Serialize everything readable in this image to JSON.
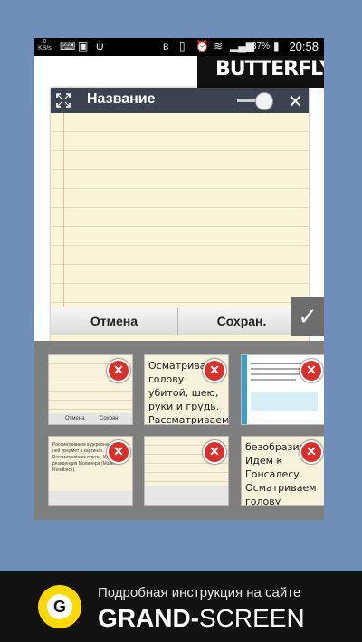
{
  "statusbar": {
    "speed_value": "0",
    "speed_unit": "KB/s",
    "battery": "87%",
    "time": "20:58"
  },
  "background_app": {
    "logo_text": "BUTTERFLY"
  },
  "memo_window": {
    "title": "Название",
    "cancel_label": "Отмена",
    "save_label": "Сохран."
  },
  "thumbnails": [
    {
      "kind": "memo",
      "cancel": "Отмена",
      "save": "Сохран."
    },
    {
      "kind": "text",
      "text": "Осматриваем голову убитой, шею, руки и грудь. Рассматриваем"
    },
    {
      "kind": "web"
    },
    {
      "kind": "small_text",
      "text": "Рассматриваем в деревню, сквозь ней предмет в картинах. Рассматриваем сквозь. Идем резиденция Молинера (Muller Roodbeck)."
    },
    {
      "kind": "memo_keyboard"
    },
    {
      "kind": "text",
      "text": "безобразия. Идем к Гонсалесу. Осматриваем голову убитой,"
    }
  ],
  "footer": {
    "logo_letter": "G",
    "tagline": "Подробная инструкция на сайте",
    "brand_bold": "GRAND-",
    "brand_light": "SCREEN"
  },
  "colors": {
    "page_bg": "#6f8fb8",
    "memo_header": "#3b4350",
    "close_badge": "#d9302b",
    "footer_bg": "#121212",
    "footer_logo": "#ffd800"
  }
}
